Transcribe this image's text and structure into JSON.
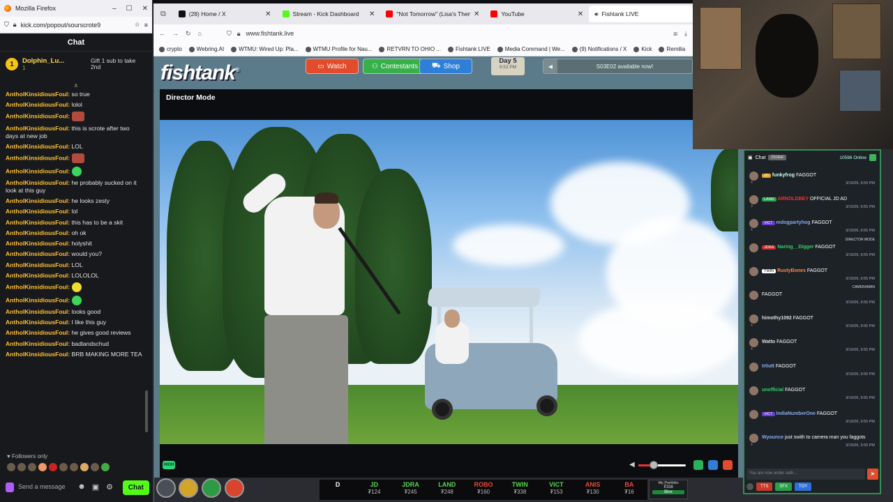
{
  "left_window": {
    "title": "Mozilla Firefox",
    "url": "kick.com/popout/sourscrote9",
    "chat_header": "Chat",
    "pinned": {
      "badge": "1",
      "user": "Dolphin_Lu...",
      "subs": "1",
      "gift_text": "Gift 1 sub to take 2nd"
    },
    "messages": [
      {
        "user": "AntholKinsidiousFoul:",
        "text": "so true"
      },
      {
        "user": "AntholKinsidiousFoul:",
        "text": "lolol"
      },
      {
        "user": "AntholKinsidiousFoul:",
        "text": "",
        "emote": "red"
      },
      {
        "user": "AntholKinsidiousFoul:",
        "text": "this is scrote after two days at new job"
      },
      {
        "user": "AntholKinsidiousFoul:",
        "text": "LOL"
      },
      {
        "user": "AntholKinsidiousFoul:",
        "text": "",
        "emote": "red"
      },
      {
        "user": "AntholKinsidiousFoul:",
        "text": "",
        "emote": "green"
      },
      {
        "user": "AntholKinsidiousFoul:",
        "text": "he probably sucked on it look at this guy"
      },
      {
        "user": "AntholKinsidiousFoul:",
        "text": "he looks zesty"
      },
      {
        "user": "AntholKinsidiousFoul:",
        "text": "lol"
      },
      {
        "user": "AntholKinsidiousFoul:",
        "text": "this has to be a skit"
      },
      {
        "user": "AntholKinsidiousFoul:",
        "text": "oh ok"
      },
      {
        "user": "AntholKinsidiousFoul:",
        "text": "holyshit"
      },
      {
        "user": "AntholKinsidiousFoul:",
        "text": "would you?"
      },
      {
        "user": "AntholKinsidiousFoul:",
        "text": "LOL"
      },
      {
        "user": "AntholKinsidiousFoul:",
        "text": "LOLOLOL"
      },
      {
        "user": "AntholKinsidiousFoul:",
        "text": "",
        "emote": "yellow"
      },
      {
        "user": "AntholKinsidiousFoul:",
        "text": "",
        "emote": "green"
      },
      {
        "user": "AntholKinsidiousFoul:",
        "text": "looks good"
      },
      {
        "user": "AntholKinsidiousFoul:",
        "text": "I like this guy"
      },
      {
        "user": "AntholKinsidiousFoul:",
        "text": "he gives good reviews"
      },
      {
        "user": "AntholKinsidiousFoul:",
        "text": "badlandschud"
      },
      {
        "user": "AntholKinsidiousFoul:",
        "text": "BRB MAKING MORE TEA"
      }
    ],
    "followers_only": "Followers only",
    "send_placeholder": "Send a message",
    "chat_button": "Chat"
  },
  "browser": {
    "tabs": [
      {
        "title": "(28) Home / X",
        "color": "#111111"
      },
      {
        "title": "Stream - Kick Dashboard",
        "color": "#53fc18"
      },
      {
        "title": "\"Not Tomorrow\" (Lisa's Theme)",
        "color": "#ff0000"
      },
      {
        "title": "YouTube",
        "color": "#ff0000"
      },
      {
        "title": "Fishtank LIVE",
        "color": "#333333"
      }
    ],
    "url": "www.fishtank.live",
    "bookmarks": [
      "crypto",
      "Webring.AI",
      "WTMU: Wired Up: Pla...",
      "WTMU Profile for Nau...",
      "RETVRN TO OHIO ...",
      "Fishtank LIVE",
      "Media Command | We...",
      "(9) Notifications / X",
      "Kick",
      "Remilia"
    ]
  },
  "fishtank": {
    "logo": "fishtank",
    "nav": {
      "watch": "Watch",
      "contestants": "Contestants",
      "shop": "Shop"
    },
    "day": "Day 5",
    "time": "9:53 PM",
    "banner": "S03E02 available now!",
    "director_mode": "Director Mode",
    "hd_badge": "HIGH",
    "players": [
      {
        "name": "D",
        "value": "",
        "color": "#ffffff"
      },
      {
        "name": "JD",
        "value": "₮124",
        "color": "#56d94d"
      },
      {
        "name": "JDRA",
        "value": "₮245",
        "color": "#56d94d"
      },
      {
        "name": "LAND",
        "value": "₮248",
        "color": "#56d94d"
      },
      {
        "name": "ROBO",
        "value": "₮160",
        "color": "#e84a3a"
      },
      {
        "name": "TWIN",
        "value": "₮338",
        "color": "#56d94d"
      },
      {
        "name": "VICT",
        "value": "₮153",
        "color": "#56d94d"
      },
      {
        "name": "ANIS",
        "value": "₮130",
        "color": "#e84a3a"
      },
      {
        "name": "BA",
        "value": "₮16",
        "color": "#e84a3a"
      }
    ],
    "portfolio": {
      "label": "My Portfolio",
      "value": "₮338",
      "status": "Blox"
    }
  },
  "right_chat": {
    "title": "Chat",
    "global": "Global",
    "online": "10596 Online",
    "messages": [
      {
        "user": "funkyfrog",
        "tag": "JD",
        "tag_color": "#e8a11e",
        "user_color": "#cfe",
        "text": "FAGGOT",
        "time": "3/19/26, 9:55 PM",
        "level": "4",
        "sys": ""
      },
      {
        "user": "ARNOLDBEY",
        "tag": "LAND",
        "tag_color": "#2aa04a",
        "user_color": "#e33",
        "text": "OFFICIAL JD AD",
        "time": "3/19/26, 9:55 PM",
        "level": "3",
        "sys": ""
      },
      {
        "user": "mdogpartyhog",
        "tag": "VICT",
        "tag_color": "#6b3bd6",
        "user_color": "#8ae",
        "text": "FAGGOT",
        "time": "3/19/26, 9:55 PM",
        "level": "4",
        "sys": ""
      },
      {
        "user": "Naring__Digger",
        "tag": "JDRA",
        "tag_color": "#c92a2a",
        "user_color": "#3c6",
        "text": "FAGGOT",
        "time": "3/19/26, 9:55 PM",
        "level": "",
        "sys": "DIRECTOR MODE"
      },
      {
        "user": "RustyBones",
        "tag": "TWIN",
        "tag_color": "#ffffff",
        "user_color": "#f84",
        "text": "FAGGOT",
        "time": "3/19/26, 9:55 PM",
        "level": "",
        "sys": ""
      },
      {
        "user": "",
        "tag": "",
        "tag_color": "",
        "user_color": "#e33",
        "text": "FAGGOT",
        "time": "3/19/26, 9:55 PM",
        "level": "",
        "sys": "CAMERAMAN"
      },
      {
        "user": "himothy1092",
        "tag": "",
        "tag_color": "",
        "user_color": "#ddd",
        "text": "FAGGOT",
        "time": "3/19/26, 9:55 PM",
        "level": "4",
        "sys": ""
      },
      {
        "user": "Watto",
        "tag": "",
        "tag_color": "",
        "user_color": "#ddd",
        "text": "FAGGOT",
        "time": "3/19/26, 9:55 PM",
        "level": "4",
        "sys": ""
      },
      {
        "user": "tr0utt",
        "tag": "",
        "tag_color": "",
        "user_color": "#8ae",
        "text": "FAGGOT",
        "time": "3/19/26, 9:55 PM",
        "level": "",
        "sys": ""
      },
      {
        "user": "unofficial",
        "tag": "",
        "tag_color": "",
        "user_color": "#3c6",
        "text": "FAGGOT",
        "time": "3/19/26, 9:55 PM",
        "level": "",
        "sys": ""
      },
      {
        "user": "IndiaNumberOne",
        "tag": "VICT",
        "tag_color": "#6b3bd6",
        "user_color": "#8ae",
        "text": "FAGGOT",
        "time": "3/19/26, 9:55 PM",
        "level": "",
        "sys": ""
      },
      {
        "user": "Wyounce",
        "tag": "",
        "tag_color": "",
        "user_color": "#8ae",
        "text": "just swith to camera man you faggots",
        "time": "3/19/26, 9:55 PM",
        "level": "4",
        "sys": ""
      }
    ],
    "input_placeholder": "You are now under oath...",
    "footer": [
      {
        "label": "TTS",
        "color": "#c83a2a"
      },
      {
        "label": "SFX",
        "color": "#2aa04a"
      },
      {
        "label": "TOY",
        "color": "#2f6fd8"
      }
    ]
  }
}
